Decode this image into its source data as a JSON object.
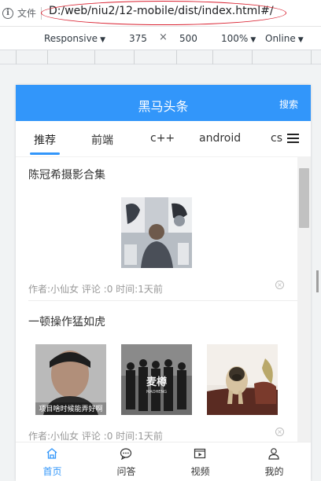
{
  "browser": {
    "file_label": "文件",
    "url": "D:/web/niu2/12-mobile/dist/index.html#/"
  },
  "device_toolbar": {
    "mode": "Responsive",
    "width": "375",
    "times": "×",
    "height": "500",
    "zoom": "100%",
    "network": "Online"
  },
  "app": {
    "title": "黑马头条",
    "search_label": "搜索",
    "accent_color": "#3296fa"
  },
  "channels": [
    {
      "label": "推荐",
      "active": true
    },
    {
      "label": "前端"
    },
    {
      "label": "c++"
    },
    {
      "label": "android"
    },
    {
      "label": "cs"
    }
  ],
  "articles": [
    {
      "title": "陈冠希摄影合集",
      "meta": "作者:小仙女 评论 :0 时间:1天前",
      "image_count": 1
    },
    {
      "title": "一顿操作猛如虎",
      "meta": "作者:小仙女 评论 :0 时间:1天前",
      "image_count": 3,
      "image_captions": [
        "项目啥时候能弄好啊",
        "麦樽",
        "MAOHENG"
      ]
    }
  ],
  "tabbar": [
    {
      "label": "首页",
      "icon": "home-icon",
      "active": true
    },
    {
      "label": "问答",
      "icon": "chat-icon"
    },
    {
      "label": "视频",
      "icon": "video-icon"
    },
    {
      "label": "我的",
      "icon": "user-icon"
    }
  ]
}
